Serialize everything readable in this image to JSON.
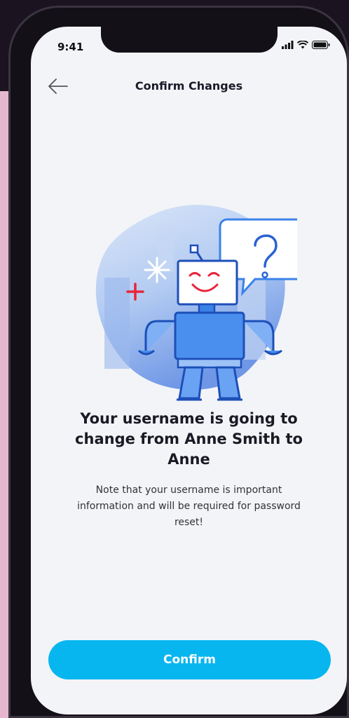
{
  "status_bar": {
    "time": "9:41"
  },
  "header": {
    "title": "Confirm Changes",
    "back_icon": "arrow-left-icon"
  },
  "main": {
    "headline": "Your username is going to change from Anne Smith to Anne",
    "note": "Note that your username is important information and will be required for password reset!"
  },
  "footer": {
    "confirm_label": "Confirm"
  },
  "colors": {
    "accent": "#08b6ef",
    "background": "#f3f4f8",
    "robot_blue": "#3b82e8"
  }
}
